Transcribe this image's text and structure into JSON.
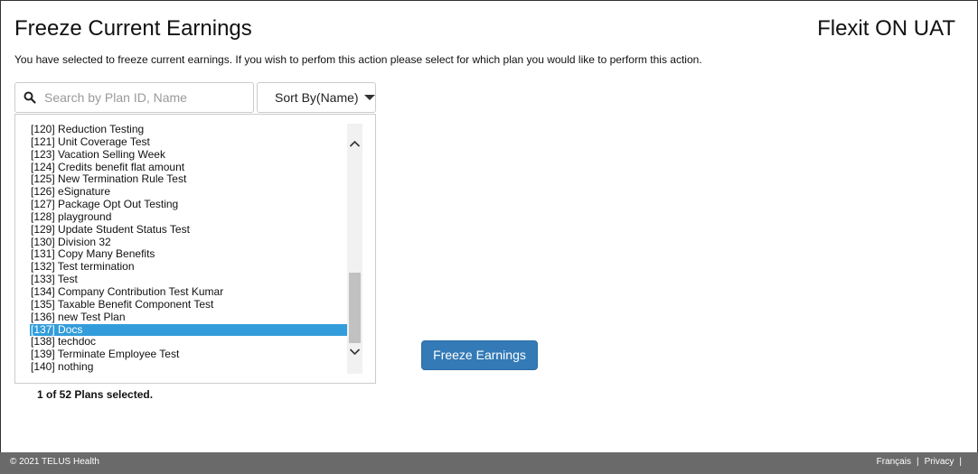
{
  "header": {
    "title": "Freeze Current Earnings",
    "environment": "Flexit ON UAT"
  },
  "instruction": "You have selected to freeze current earnings. If you wish to perfom this action please select for which plan you would like to perform this action.",
  "search": {
    "placeholder": "Search by Plan ID, Name",
    "value": "",
    "icon": "search-icon"
  },
  "sort": {
    "label": "Sort By(Name)",
    "icon": "caret-down-icon"
  },
  "plans": [
    "[120] Reduction Testing",
    "[121] Unit Coverage Test",
    "[123] Vacation Selling Week",
    "[124] Credits benefit flat amount",
    "[125] New Termination Rule Test",
    "[126] eSignature",
    "[127] Package Opt Out Testing",
    "[128] playground",
    "[129] Update Student Status Test",
    "[130] Division 32",
    "[131] Copy Many Benefits",
    "[132] Test termination",
    "[133] Test",
    "[134] Company Contribution Test Kumar",
    "[135] Taxable Benefit Component Test",
    "[136] new Test Plan",
    "[137] Docs",
    "[138] techdoc",
    "[139] Terminate Employee Test",
    "[140] nothing"
  ],
  "selected_plan": "[137] Docs",
  "selection_status": "1 of 52 Plans selected.",
  "action_button": "Freeze Earnings",
  "footer": {
    "copyright": "© 2021 TELUS Health",
    "links": [
      "Français",
      "Privacy"
    ],
    "separator": "|"
  },
  "colors": {
    "primary_button": "#337ab7",
    "selected_row": "#339ddb",
    "footer_bg": "#6a6a6a"
  }
}
